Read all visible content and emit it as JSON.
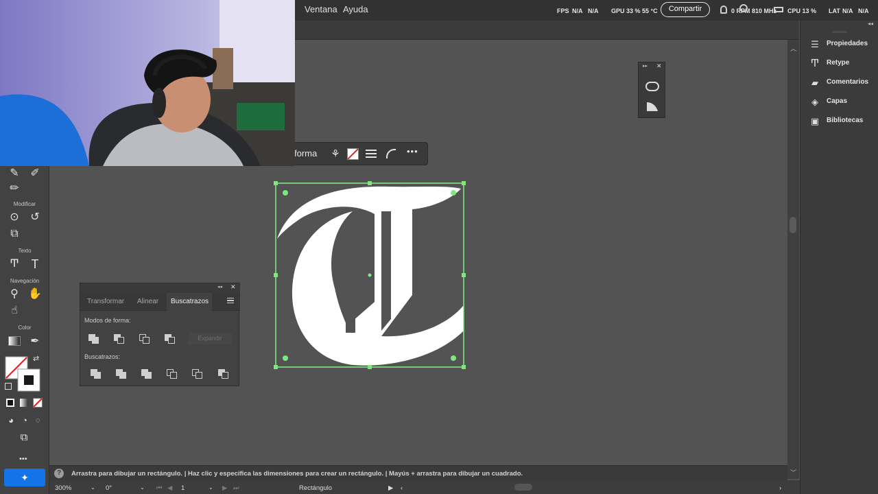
{
  "menubar": {
    "items": [
      "Ventana",
      "Ayuda"
    ],
    "share_label": "Compartir",
    "perf": {
      "fps_label": "FPS",
      "fps_value1": "N/A",
      "fps_value2": "N/A",
      "gpu": "GPU 33 % 55 °C",
      "rpm": "0 RPM 810 MHz",
      "cpu": "CPU 13 %",
      "lat_label": "LAT",
      "lat_value1": "N/A",
      "lat_value2": "N/A"
    }
  },
  "toolbar": {
    "labels": {
      "modificar": "Modificar",
      "texto": "Texto",
      "navegacion": "Navegación",
      "color": "Color"
    },
    "more": "•••"
  },
  "taskbar": {
    "label": "forma"
  },
  "pathfinder": {
    "tabs": [
      "Transformar",
      "Alinear",
      "Buscatrazos"
    ],
    "active_tab": "Buscatrazos",
    "shape_modes_label": "Modos de forma:",
    "expand_label": "Expandir",
    "pathfinders_label": "Buscatrazos:"
  },
  "right_dock": {
    "items": [
      {
        "label": "Propiedades",
        "icon": "sliders-icon"
      },
      {
        "label": "Retype",
        "icon": "retype-icon"
      },
      {
        "label": "Comentarios",
        "icon": "comment-icon"
      },
      {
        "label": "Capas",
        "icon": "layers-icon"
      },
      {
        "label": "Bibliotecas",
        "icon": "libraries-icon"
      }
    ]
  },
  "status": {
    "hint": "Arrastra para dibujar un rectángulo.  |  Haz clic y especifica las dimensiones para crear un rectángulo.  |  Mayús + arrastra para dibujar un cuadrado.",
    "zoom": "300%",
    "rotation": "0°",
    "artboard": "1",
    "tool": "Rectángulo"
  },
  "colors": {
    "selection": "#7ee87e",
    "glyph": "#ffffff",
    "accent": "#1473e6"
  }
}
